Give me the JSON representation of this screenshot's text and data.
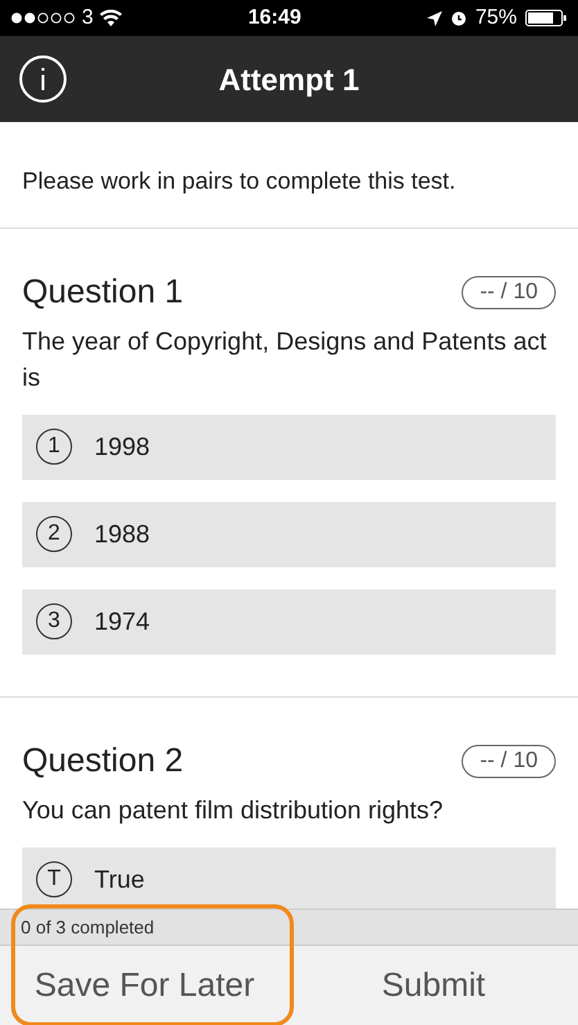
{
  "status_bar": {
    "carrier": "3",
    "time": "16:49",
    "battery": "75%"
  },
  "header": {
    "title": "Attempt 1"
  },
  "intro": "Please work in pairs to complete this test.",
  "questions": [
    {
      "title": "Question 1",
      "score": "-- / 10",
      "prompt": "The year of Copyright, Designs and Patents act is",
      "options": [
        {
          "marker": "1",
          "label": "1998"
        },
        {
          "marker": "2",
          "label": "1988"
        },
        {
          "marker": "3",
          "label": "1974"
        }
      ]
    },
    {
      "title": "Question 2",
      "score": "-- / 10",
      "prompt": "You can patent film distribution rights?",
      "options": [
        {
          "marker": "T",
          "label": "True"
        }
      ]
    }
  ],
  "progress": "0 of 3 completed",
  "buttons": [
    {
      "label": "Save For Later",
      "highlighted": true
    },
    {
      "label": "Submit",
      "highlighted": false
    }
  ]
}
